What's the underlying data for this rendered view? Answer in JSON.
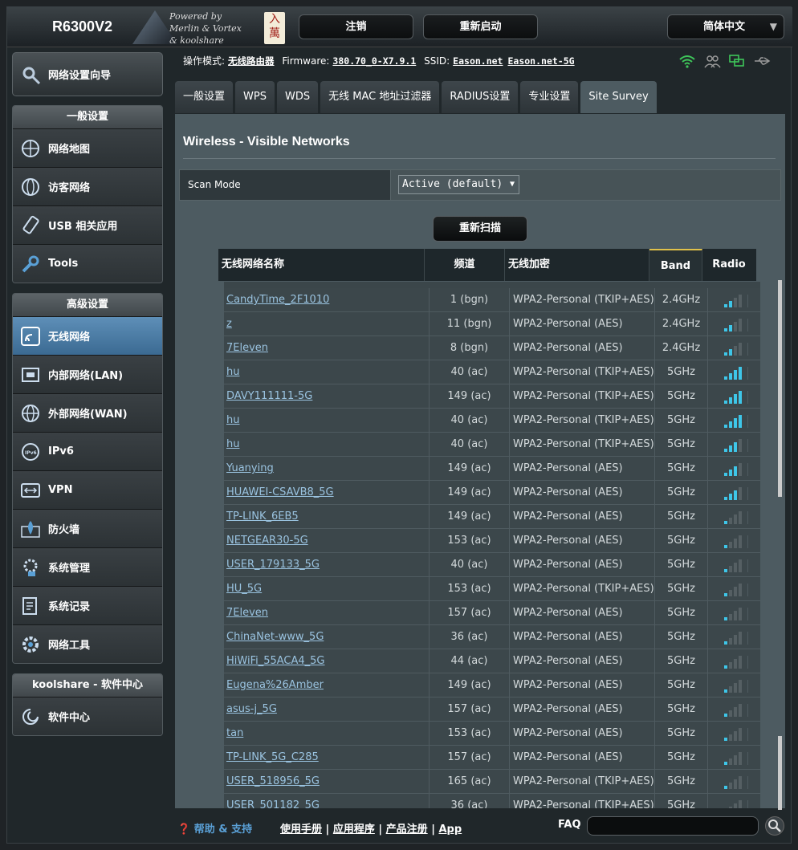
{
  "header": {
    "model": "R6300V2",
    "powered_line1": "Powered by",
    "powered_line2": "Merlin & Vortex",
    "powered_line3": "& koolshare",
    "seal_text": "入萬",
    "logout": "注销",
    "reboot": "重新启动",
    "language": "简体中文"
  },
  "status": {
    "mode_label": "操作模式:",
    "mode_value": "无线路由器",
    "firmware_label": "Firmware:",
    "firmware_value": "380.70_0-X7.9.1",
    "ssid_label": "SSID:",
    "ssid_1": "Eason.net",
    "ssid_2": "Eason.net-5G",
    "icons": [
      "wifi-icon",
      "users-icon",
      "network-icon",
      "usb-icon"
    ]
  },
  "sidebar": {
    "wizard": "网络设置向导",
    "general_head": "一般设置",
    "general": [
      "网络地图",
      "访客网络",
      "USB 相关应用",
      "Tools"
    ],
    "advanced_head": "高级设置",
    "advanced": [
      "无线网络",
      "内部网络(LAN)",
      "外部网络(WAN)",
      "IPv6",
      "VPN",
      "防火墙",
      "系统管理",
      "系统记录",
      "网络工具"
    ],
    "active_index": 0,
    "koolshare_head": "koolshare - 软件中心",
    "koolshare": [
      "软件中心"
    ]
  },
  "tabs": [
    "一般设置",
    "WPS",
    "WDS",
    "无线 MAC 地址过滤器",
    "RADIUS设置",
    "专业设置",
    "Site Survey"
  ],
  "active_tab": 6,
  "content": {
    "title": "Wireless - Visible Networks",
    "scan_mode_label": "Scan Mode",
    "scan_mode_value": "Active (default)",
    "rescan": "重新扫描"
  },
  "table": {
    "headers": [
      "无线网络名称",
      "频道",
      "无线加密",
      "Band",
      "Radio"
    ],
    "rows": [
      {
        "ssid": "CandyTime_2F1010",
        "channel": "1 (bgn)",
        "encryption": "WPA2-Personal (TKIP+AES)",
        "band": "2.4GHz",
        "signal": 2
      },
      {
        "ssid": "z",
        "channel": "11 (bgn)",
        "encryption": "WPA2-Personal (AES)",
        "band": "2.4GHz",
        "signal": 2
      },
      {
        "ssid": "7Eleven",
        "channel": "8 (bgn)",
        "encryption": "WPA2-Personal (AES)",
        "band": "2.4GHz",
        "signal": 2
      },
      {
        "ssid": "hu",
        "channel": "40 (ac)",
        "encryption": "WPA2-Personal (TKIP+AES)",
        "band": "5GHz",
        "signal": 4
      },
      {
        "ssid": "DAVY111111-5G",
        "channel": "149 (ac)",
        "encryption": "WPA2-Personal (TKIP+AES)",
        "band": "5GHz",
        "signal": 4
      },
      {
        "ssid": "hu",
        "channel": "40 (ac)",
        "encryption": "WPA2-Personal (TKIP+AES)",
        "band": "5GHz",
        "signal": 4
      },
      {
        "ssid": "hu",
        "channel": "40 (ac)",
        "encryption": "WPA2-Personal (TKIP+AES)",
        "band": "5GHz",
        "signal": 3
      },
      {
        "ssid": "Yuanying",
        "channel": "149 (ac)",
        "encryption": "WPA2-Personal (AES)",
        "band": "5GHz",
        "signal": 3
      },
      {
        "ssid": "HUAWEI-CSAVB8_5G",
        "channel": "149 (ac)",
        "encryption": "WPA2-Personal (AES)",
        "band": "5GHz",
        "signal": 3
      },
      {
        "ssid": "TP-LINK_6EB5",
        "channel": "149 (ac)",
        "encryption": "WPA2-Personal (AES)",
        "band": "5GHz",
        "signal": 1
      },
      {
        "ssid": "NETGEAR30-5G",
        "channel": "153 (ac)",
        "encryption": "WPA2-Personal (AES)",
        "band": "5GHz",
        "signal": 1
      },
      {
        "ssid": "USER_179133_5G",
        "channel": "40 (ac)",
        "encryption": "WPA2-Personal (AES)",
        "band": "5GHz",
        "signal": 1
      },
      {
        "ssid": "HU_5G",
        "channel": "153 (ac)",
        "encryption": "WPA2-Personal (TKIP+AES)",
        "band": "5GHz",
        "signal": 1
      },
      {
        "ssid": "7Eleven",
        "channel": "157 (ac)",
        "encryption": "WPA2-Personal (AES)",
        "band": "5GHz",
        "signal": 1
      },
      {
        "ssid": "ChinaNet-www_5G",
        "channel": "36 (ac)",
        "encryption": "WPA2-Personal (AES)",
        "band": "5GHz",
        "signal": 1
      },
      {
        "ssid": "HiWiFi_55ACA4_5G",
        "channel": "44 (ac)",
        "encryption": "WPA2-Personal (AES)",
        "band": "5GHz",
        "signal": 1
      },
      {
        "ssid": "Eugena%26Amber",
        "channel": "149 (ac)",
        "encryption": "WPA2-Personal (AES)",
        "band": "5GHz",
        "signal": 1
      },
      {
        "ssid": "asus-j_5G",
        "channel": "157 (ac)",
        "encryption": "WPA2-Personal (AES)",
        "band": "5GHz",
        "signal": 1
      },
      {
        "ssid": "tan",
        "channel": "153 (ac)",
        "encryption": "WPA2-Personal (AES)",
        "band": "5GHz",
        "signal": 1
      },
      {
        "ssid": "TP-LINK_5G_C285",
        "channel": "157 (ac)",
        "encryption": "WPA2-Personal (AES)",
        "band": "5GHz",
        "signal": 1
      },
      {
        "ssid": "USER_518956_5G",
        "channel": "165 (ac)",
        "encryption": "WPA2-Personal (TKIP+AES)",
        "band": "5GHz",
        "signal": 1
      },
      {
        "ssid": "USER_501182_5G",
        "channel": "36 (ac)",
        "encryption": "WPA2-Personal (TKIP+AES)",
        "band": "5GHz",
        "signal": 1
      }
    ]
  },
  "footer": {
    "help": "帮助 & 支持",
    "links": [
      "使用手册",
      "应用程序",
      "产品注册",
      "App"
    ],
    "separator": "|",
    "faq": "FAQ"
  },
  "colors": {
    "accent": "#5aa0d6",
    "signal_on": "#3ec6e8",
    "active_tab_bar": "#e0c14a"
  }
}
